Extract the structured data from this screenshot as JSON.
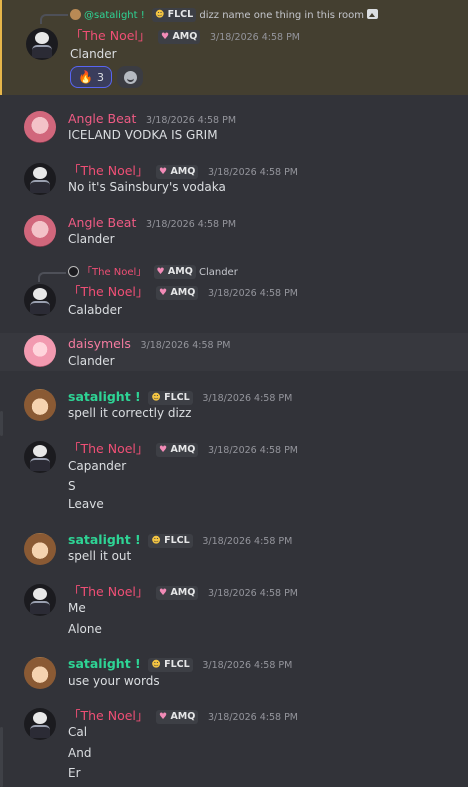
{
  "colors": {
    "background": "#323339",
    "highlight": "#443f30",
    "accent_mention": "#e6b64a",
    "noel": "#ef4f75",
    "satalight": "#2ed495"
  },
  "messages": [
    {
      "author": "「The Noel」",
      "tag": "AMQ",
      "time": "3/18/2026 4:58 PM",
      "reply": {
        "author": "@satalight !",
        "tag": "FLCL",
        "text": "dizz name one thing in this room"
      },
      "lines": [
        "Clander"
      ],
      "reactions": [
        {
          "emoji": "🔥",
          "count": "3"
        }
      ]
    },
    {
      "author": "Angle Beat",
      "time": "3/18/2026 4:58 PM",
      "lines": [
        "ICELAND VODKA IS GRIM"
      ]
    },
    {
      "author": "「The Noel」",
      "tag": "AMQ",
      "time": "3/18/2026 4:58 PM",
      "lines": [
        "No it's Sainsbury's vodaka"
      ]
    },
    {
      "author": "Angle Beat",
      "time": "3/18/2026 4:58 PM",
      "lines": [
        "Clander"
      ]
    },
    {
      "author": "「The Noel」",
      "tag": "AMQ",
      "time": "3/18/2026 4:58 PM",
      "reply": {
        "author": "「The Noel」",
        "tag": "AMQ",
        "text": "Clander"
      },
      "lines": [
        "Calabder"
      ]
    },
    {
      "author": "daisymels",
      "time": "3/18/2026 4:58 PM",
      "lines": [
        "Clander"
      ]
    },
    {
      "author": "satalight !",
      "tag": "FLCL",
      "time": "3/18/2026 4:58 PM",
      "lines": [
        "spell it correctly dizz"
      ]
    },
    {
      "author": "「The Noel」",
      "tag": "AMQ",
      "time": "3/18/2026 4:58 PM",
      "lines": [
        "Capander",
        "S",
        "Leave"
      ]
    },
    {
      "author": "satalight !",
      "tag": "FLCL",
      "time": "3/18/2026 4:58 PM",
      "lines": [
        "spell it out"
      ]
    },
    {
      "author": "「The Noel」",
      "tag": "AMQ",
      "time": "3/18/2026 4:58 PM",
      "lines": [
        "Me",
        "Alone"
      ]
    },
    {
      "author": "satalight !",
      "tag": "FLCL",
      "time": "3/18/2026 4:58 PM",
      "lines": [
        "use your words"
      ]
    },
    {
      "author": "「The Noel」",
      "tag": "AMQ",
      "time": "3/18/2026 4:58 PM",
      "lines": [
        "Cal",
        "And",
        "Er"
      ]
    }
  ]
}
